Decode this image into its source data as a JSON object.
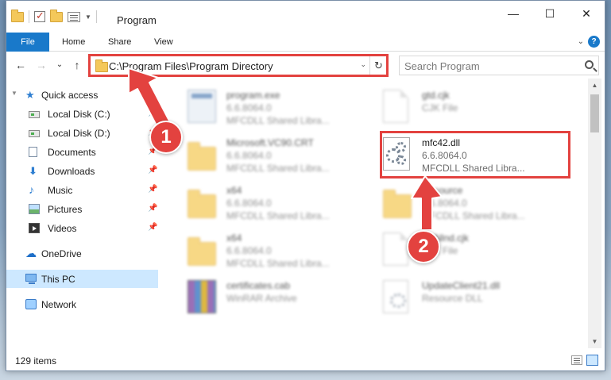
{
  "window": {
    "title": "Program",
    "controls": {
      "minimize": "—",
      "maximize": "☐",
      "close": "✕"
    }
  },
  "ribbon": {
    "tabs": [
      {
        "label": "File",
        "active": true
      },
      {
        "label": "Home"
      },
      {
        "label": "Share"
      },
      {
        "label": "View"
      }
    ],
    "help": "?"
  },
  "navigation": {
    "back": "←",
    "forward": "→",
    "recent": "⌄",
    "up": "↑"
  },
  "address_bar": {
    "path": "C:\\Program Files\\Program Directory",
    "dropdown": "⌄",
    "refresh": "↻"
  },
  "search": {
    "placeholder": "Search Program"
  },
  "sidebar": {
    "quick_access": "Quick access",
    "items": [
      {
        "label": "Local Disk (C:)",
        "pinned": true
      },
      {
        "label": "Local Disk (D:)",
        "pinned": true
      },
      {
        "label": "Documents",
        "pinned": true
      },
      {
        "label": "Downloads",
        "pinned": true
      },
      {
        "label": "Music",
        "pinned": true
      },
      {
        "label": "Pictures",
        "pinned": true
      },
      {
        "label": "Videos",
        "pinned": true
      }
    ],
    "onedrive": "OneDrive",
    "this_pc": "This PC",
    "network": "Network",
    "pin_glyph": "📌"
  },
  "files": [
    {
      "name": "program.exe",
      "version": "6.6.8064.0",
      "description": "MFCDLL Shared Libra..."
    },
    {
      "name": "gtd.cjk",
      "version": "CJK File",
      "description": ""
    },
    {
      "name": "Microsoft.VC90.CRT",
      "version": "6.6.8064.0",
      "description": "MFCDLL Shared Libra..."
    },
    {
      "name": "mfc42.dll",
      "version": "6.6.8064.0",
      "description": "MFCDLL Shared Libra..."
    },
    {
      "name": "x64",
      "version": "6.6.8064.0",
      "description": "MFCDLL Shared Libra..."
    },
    {
      "name": "Resource",
      "version": "6.6.8064.0",
      "description": "MFCDLL Shared Libra..."
    },
    {
      "name": "x64",
      "version": "6.6.8064.0",
      "description": "MFCDLL Shared Libra..."
    },
    {
      "name": "uniNlnd.cjk",
      "version": "CJK File",
      "description": ""
    },
    {
      "name": "certificates.cab",
      "version": "WinRAR Archive",
      "description": ""
    },
    {
      "name": "UpdateClient21.dll",
      "version": "Resource DLL",
      "description": ""
    }
  ],
  "status_bar": {
    "item_count": "129 items"
  },
  "annotations": {
    "step1": "1",
    "step2": "2",
    "accent_color": "#e3423f"
  },
  "colors": {
    "file_tab": "#1979ca",
    "selected_nav": "#cde8ff",
    "highlight": "#e3423f"
  }
}
